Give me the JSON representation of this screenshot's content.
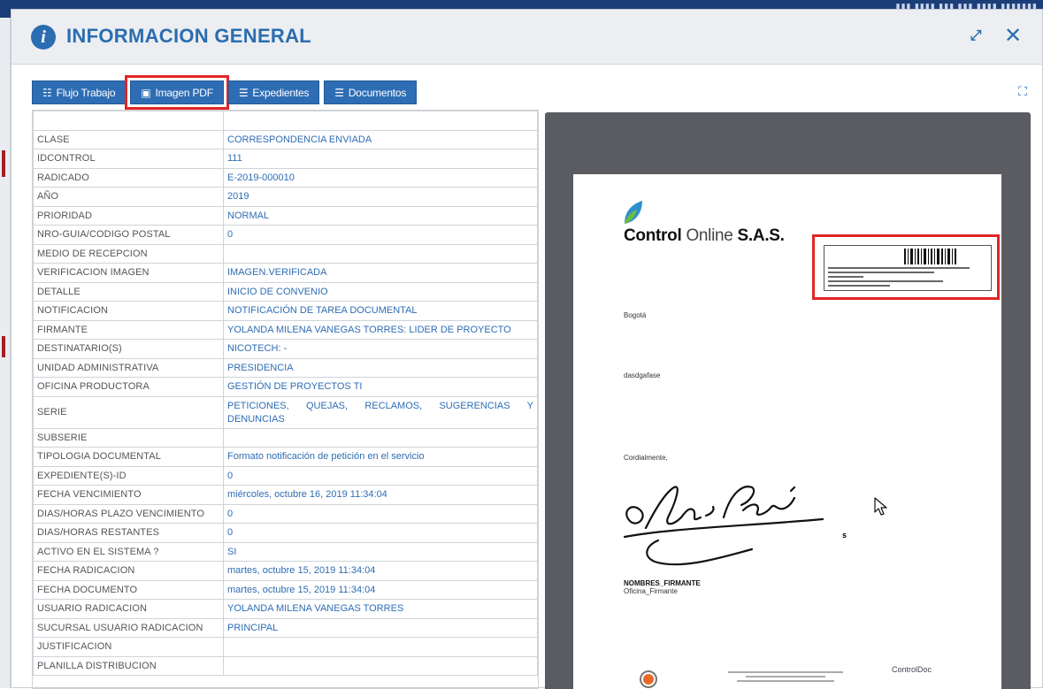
{
  "modal": {
    "title": "INFORMACION GENERAL",
    "info_icon_glyph": "i"
  },
  "tabs": [
    {
      "label": "Flujo Trabajo",
      "icon": "sitemap-icon",
      "active": false
    },
    {
      "label": "Imagen PDF",
      "icon": "image-icon",
      "active": true
    },
    {
      "label": "Expedientes",
      "icon": "list-icon",
      "active": false
    },
    {
      "label": "Documentos",
      "icon": "list-icon",
      "active": false
    }
  ],
  "info_table": [
    {
      "key": "",
      "value": ""
    },
    {
      "key": "CLASE",
      "value": "CORRESPONDENCIA ENVIADA"
    },
    {
      "key": "IDCONTROL",
      "value": "111"
    },
    {
      "key": "RADICADO",
      "value": "E-2019-000010"
    },
    {
      "key": "AÑO",
      "value": "2019"
    },
    {
      "key": "PRIORIDAD",
      "value": "NORMAL"
    },
    {
      "key": "NRO-GUIA/CODIGO POSTAL",
      "value": "0"
    },
    {
      "key": "MEDIO DE RECEPCION",
      "value": ""
    },
    {
      "key": "VERIFICACION IMAGEN",
      "value": "IMAGEN.VERIFICADA"
    },
    {
      "key": "DETALLE",
      "value": "INICIO DE CONVENIO"
    },
    {
      "key": "NOTIFICACION",
      "value": "NOTIFICACIÓN DE TAREA DOCUMENTAL"
    },
    {
      "key": "FIRMANTE",
      "value": "YOLANDA MILENA VANEGAS TORRES: LIDER DE PROYECTO"
    },
    {
      "key": "DESTINATARIO(S)",
      "value": "NICOTECH: -"
    },
    {
      "key": "UNIDAD ADMINISTRATIVA",
      "value": "PRESIDENCIA"
    },
    {
      "key": "OFICINA PRODUCTORA",
      "value": "GESTIÓN DE PROYECTOS TI"
    },
    {
      "key": "SERIE",
      "value": "PETICIONES, QUEJAS, RECLAMOS, SUGERENCIAS Y DENUNCIAS"
    },
    {
      "key": "SUBSERIE",
      "value": ""
    },
    {
      "key": "TIPOLOGIA DOCUMENTAL",
      "value": "Formato notificación de petición en el servicio"
    },
    {
      "key": "EXPEDIENTE(S)-ID",
      "value": "0"
    },
    {
      "key": "FECHA VENCIMIENTO",
      "value": "miércoles, octubre 16, 2019 11:34:04"
    },
    {
      "key": "DIAS/HORAS PLAZO VENCIMIENTO",
      "value": "0"
    },
    {
      "key": "DIAS/HORAS RESTANTES",
      "value": "0"
    },
    {
      "key": "ACTIVO EN EL SISTEMA ?",
      "value": "SI"
    },
    {
      "key": "FECHA RADICACION",
      "value": "martes, octubre 15, 2019 11:34:04"
    },
    {
      "key": "FECHA DOCUMENTO",
      "value": "martes, octubre 15, 2019 11:34:04"
    },
    {
      "key": "USUARIO RADICACION",
      "value": "YOLANDA MILENA VANEGAS TORRES"
    },
    {
      "key": "SUCURSAL USUARIO RADICACION",
      "value": "PRINCIPAL"
    },
    {
      "key": "JUSTIFICACION",
      "value": ""
    },
    {
      "key": "PLANILLA DISTRIBUCION",
      "value": ""
    }
  ],
  "pdf_preview": {
    "company_bold": "Control",
    "company_light": "Online",
    "company_suffix": "S.A.S.",
    "city": "Bogotá",
    "subject": "dasdgafase",
    "closing": "Cordialmente,",
    "signer_name": "NOMBRES_FIRMANTE",
    "signer_role": "Oficina_Firmante",
    "footer_brand": "ControlDoc"
  },
  "colors": {
    "accent": "#2e6db4",
    "highlight": "#e02626",
    "preview_bg": "#5a5c61"
  }
}
